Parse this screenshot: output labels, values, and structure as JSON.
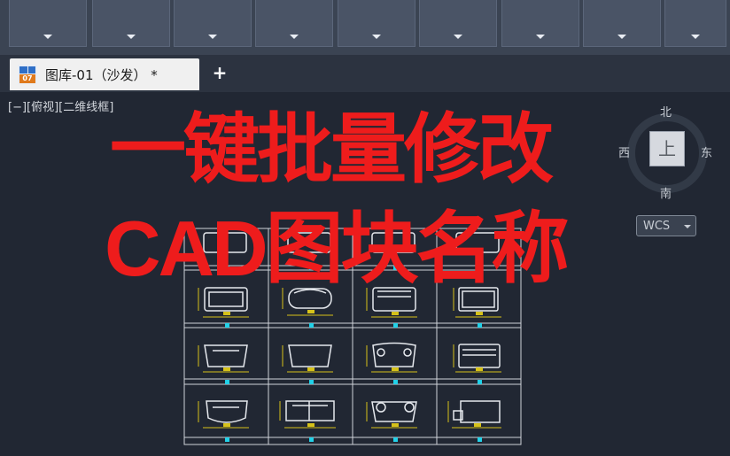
{
  "ribbon": {
    "button_count": 9
  },
  "tab": {
    "title": "图库-01（沙发） *",
    "icon_badge": "07"
  },
  "new_tab_symbol": "+",
  "viewport": {
    "label": "[−][俯视][二维线框]"
  },
  "overlay_text": {
    "line1": "一键批量修改",
    "line2": "CAD图块名称"
  },
  "viewcube": {
    "north": "北",
    "south": "南",
    "east": "东",
    "west": "西",
    "top": "上",
    "wcs": "WCS"
  },
  "colors": {
    "overlay": "#ee1c1c",
    "canvas": "#212733",
    "ribbon": "#3b4453",
    "block_line": "#e6e9ee",
    "dimension": "#d6c21a",
    "label": "#22d1e8",
    "grid_line": "#cfd3d9"
  },
  "drawing": {
    "columns": 4,
    "rows": 4,
    "description_visible": false
  }
}
